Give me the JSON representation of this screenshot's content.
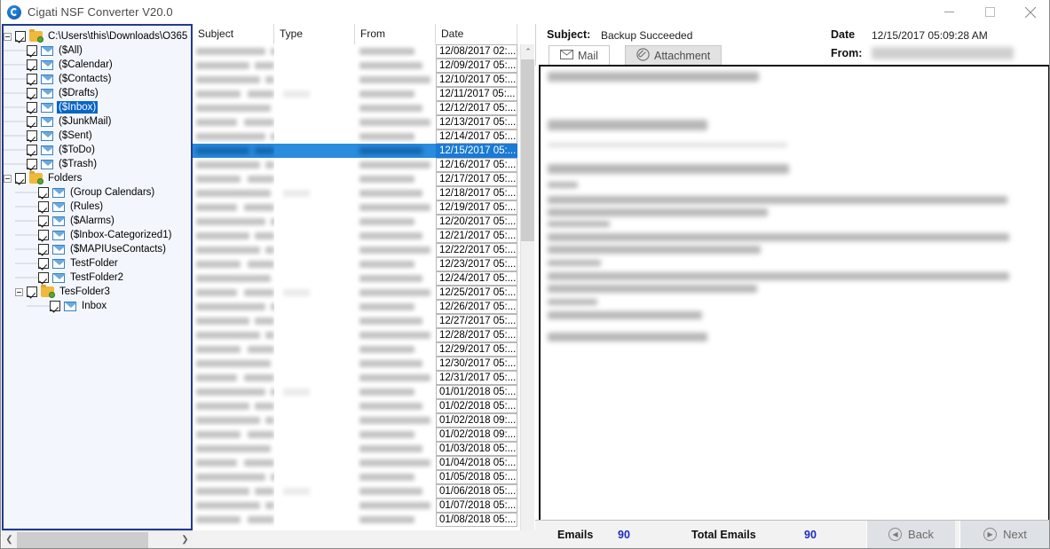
{
  "window": {
    "title": "Cigati NSF Converter V20.0",
    "icon": "app-logo-icon",
    "minimize": "minimize-icon",
    "maximize": "maximize-icon",
    "close": "close-icon"
  },
  "tree": {
    "root": {
      "label": "C:\\Users\\this\\Downloads\\O365",
      "icon": "folder-icon",
      "checked": true,
      "expanded": true
    },
    "items": [
      {
        "label": "($All)",
        "icon": "mail-icon",
        "checked": true,
        "depth": 1,
        "selected": false
      },
      {
        "label": "($Calendar)",
        "icon": "mail-icon",
        "checked": true,
        "depth": 1,
        "selected": false
      },
      {
        "label": "($Contacts)",
        "icon": "mail-icon",
        "checked": true,
        "depth": 1,
        "selected": false
      },
      {
        "label": "($Drafts)",
        "icon": "mail-icon",
        "checked": true,
        "depth": 1,
        "selected": false
      },
      {
        "label": "($Inbox)",
        "icon": "mail-icon",
        "checked": true,
        "depth": 1,
        "selected": true
      },
      {
        "label": "($JunkMail)",
        "icon": "mail-icon",
        "checked": true,
        "depth": 1,
        "selected": false
      },
      {
        "label": "($Sent)",
        "icon": "mail-icon",
        "checked": true,
        "depth": 1,
        "selected": false
      },
      {
        "label": "($ToDo)",
        "icon": "mail-icon",
        "checked": true,
        "depth": 1,
        "selected": false
      },
      {
        "label": "($Trash)",
        "icon": "mail-icon",
        "checked": true,
        "depth": 1,
        "selected": false
      },
      {
        "label": "Folders",
        "icon": "folder-icon",
        "checked": true,
        "depth": 1,
        "selected": false,
        "expanded": true
      },
      {
        "label": "(Group Calendars)",
        "icon": "mail-icon",
        "checked": true,
        "depth": 2,
        "selected": false
      },
      {
        "label": "(Rules)",
        "icon": "mail-icon",
        "checked": true,
        "depth": 2,
        "selected": false
      },
      {
        "label": "($Alarms)",
        "icon": "mail-icon",
        "checked": true,
        "depth": 2,
        "selected": false
      },
      {
        "label": "($Inbox-Categorized1)",
        "icon": "mail-icon",
        "checked": true,
        "depth": 2,
        "selected": false
      },
      {
        "label": "($MAPIUseContacts)",
        "icon": "mail-icon",
        "checked": true,
        "depth": 2,
        "selected": false
      },
      {
        "label": "TestFolder",
        "icon": "mail-icon",
        "checked": true,
        "depth": 2,
        "selected": false
      },
      {
        "label": "TestFolder2",
        "icon": "mail-icon",
        "checked": true,
        "depth": 2,
        "selected": false
      },
      {
        "label": "TesFolder3",
        "icon": "folder-icon",
        "checked": true,
        "depth": 2,
        "selected": false,
        "expanded": true
      },
      {
        "label": "Inbox",
        "icon": "mail-icon",
        "checked": true,
        "depth": 3,
        "selected": false
      }
    ],
    "hscroll": {
      "left_arrow": "❮",
      "right_arrow": "❯"
    }
  },
  "list": {
    "columns": [
      {
        "key": "subject",
        "label": "Subject"
      },
      {
        "key": "type",
        "label": "Type"
      },
      {
        "key": "from",
        "label": "From"
      },
      {
        "key": "date",
        "label": "Date"
      }
    ],
    "selected_index": 7,
    "rows": [
      {
        "date": "12/08/2017 02:..."
      },
      {
        "date": "12/09/2017 05:..."
      },
      {
        "date": "12/10/2017 05:..."
      },
      {
        "date": "12/11/2017 05:..."
      },
      {
        "date": "12/12/2017 05:..."
      },
      {
        "date": "12/13/2017 05:..."
      },
      {
        "date": "12/14/2017 05:..."
      },
      {
        "date": "12/15/2017 05:..."
      },
      {
        "date": "12/16/2017 05:..."
      },
      {
        "date": "12/17/2017 05:..."
      },
      {
        "date": "12/18/2017 05:..."
      },
      {
        "date": "12/19/2017 05:..."
      },
      {
        "date": "12/20/2017 05:..."
      },
      {
        "date": "12/21/2017 05:..."
      },
      {
        "date": "12/22/2017 05:..."
      },
      {
        "date": "12/23/2017 05:..."
      },
      {
        "date": "12/24/2017 05:..."
      },
      {
        "date": "12/25/2017 05:..."
      },
      {
        "date": "12/26/2017 05:..."
      },
      {
        "date": "12/27/2017 05:..."
      },
      {
        "date": "12/28/2017 05:..."
      },
      {
        "date": "12/29/2017 05:..."
      },
      {
        "date": "12/30/2017 05:..."
      },
      {
        "date": "12/31/2017 05:..."
      },
      {
        "date": "01/01/2018 05:..."
      },
      {
        "date": "01/02/2018 05:..."
      },
      {
        "date": "01/02/2018 09:..."
      },
      {
        "date": "01/02/2018 09:..."
      },
      {
        "date": "01/03/2018 05:..."
      },
      {
        "date": "01/04/2018 05:..."
      },
      {
        "date": "01/05/2018 05:..."
      },
      {
        "date": "01/06/2018 05:..."
      },
      {
        "date": "01/07/2018 05:..."
      },
      {
        "date": "01/08/2018 05:..."
      }
    ],
    "vscroll": {
      "up_arrow": "⌃",
      "down_arrow": "⌄"
    }
  },
  "preview": {
    "subject_label": "Subject:",
    "subject_value": "Backup Succeeded",
    "date_label": "Date",
    "date_value": "12/15/2017 05:09:28 AM",
    "from_label": "From:",
    "from_value": "",
    "tabs": [
      {
        "label": "Mail",
        "icon": "mail-icon",
        "active": true
      },
      {
        "label": "Attachment",
        "icon": "paperclip-icon",
        "active": false
      }
    ]
  },
  "status": {
    "emails_label": "Emails",
    "emails_value": "90",
    "total_label": "Total Emails",
    "total_value": "90",
    "back_label": "Back",
    "next_label": "Next",
    "back_icon": "chevron-left-circle-icon",
    "next_icon": "chevron-right-circle-icon"
  },
  "colors": {
    "selection_blue": "#1a7ad4",
    "tree_border": "#233a8f",
    "accent_number": "#1a2bbf",
    "tree_bg": "#f3f7fd"
  }
}
